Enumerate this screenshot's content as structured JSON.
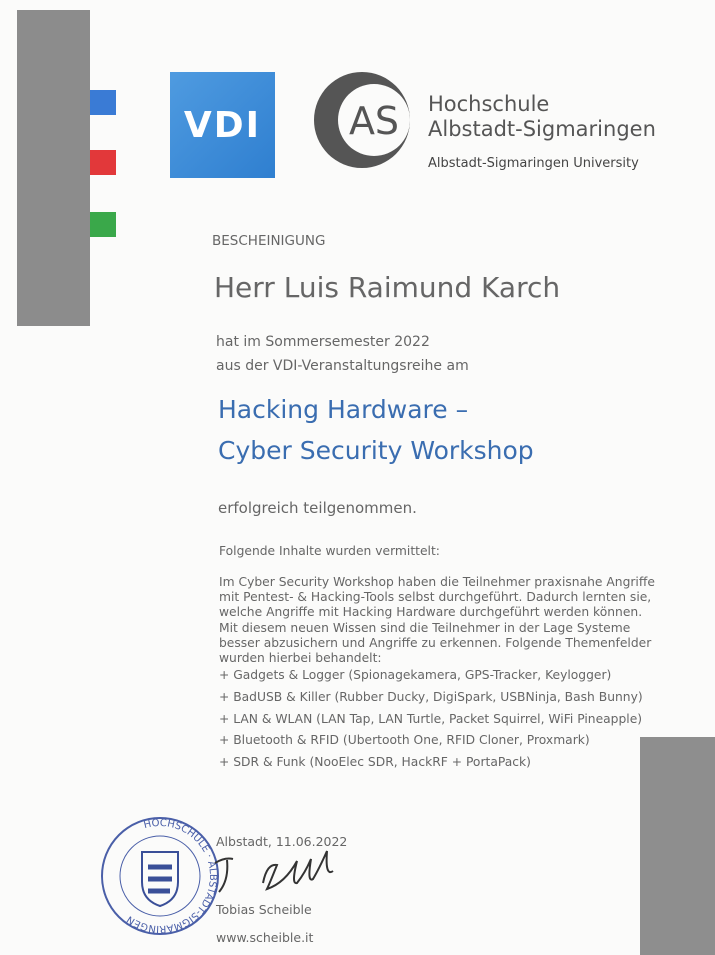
{
  "header": {
    "vdi_logo_text": "VDI",
    "as_logo_text": "AS",
    "university_name_line1": "Hochschule",
    "university_name_line2": "Albstadt-Sigmaringen",
    "university_name_en": "Albstadt-Sigmaringen University"
  },
  "certificate": {
    "heading": "BESCHEINIGUNG",
    "recipient": "Herr Luis Raimund Karch",
    "intro_line1": "hat im Sommersemester 2022",
    "intro_line2": "aus der VDI-Veranstaltungsreihe am",
    "course_title_line1": "Hacking Hardware –",
    "course_title_line2": "Cyber Security Workshop",
    "completion": "erfolgreich teilgenommen.",
    "contents_heading": "Folgende Inhalte wurden vermittelt:",
    "description": "Im Cyber Security Workshop haben die Teilnehmer praxisnahe Angriffe\nmit Pentest- & Hacking-Tools selbst durchgeführt. Dadurch lernten sie,\nwelche Angriffe mit Hacking Hardware durchgeführt werden können.\nMit diesem neuen Wissen sind die Teilnehmer in der Lage Systeme\nbesser abzusichern und Angriffe zu erkennen. Folgende Themenfelder\nwurden hierbei behandelt:",
    "topics": [
      "+ Gadgets & Logger (Spionagekamera, GPS-Tracker, Keylogger)",
      "+ BadUSB & Killer (Rubber Ducky, DigiSpark, USBNinja, Bash Bunny)",
      "+ LAN & WLAN (LAN Tap, LAN Turtle, Packet Squirrel, WiFi Pineapple)",
      "+ Bluetooth & RFID (Ubertooth One, RFID Cloner, Proxmark)",
      "+ SDR & Funk (NooElec SDR, HackRF + PortaPack)"
    ]
  },
  "footer": {
    "place_date": "Albstadt, 11.06.2022",
    "signer": "Tobias Scheible",
    "website": "www.scheible.it",
    "seal_text": "HOCHSCHULE ALBSTADT-SIGMARINGEN"
  },
  "colors": {
    "blue": "#3a7bd5",
    "red": "#e2383a",
    "green": "#3aa84a",
    "title": "#3a6db0"
  }
}
